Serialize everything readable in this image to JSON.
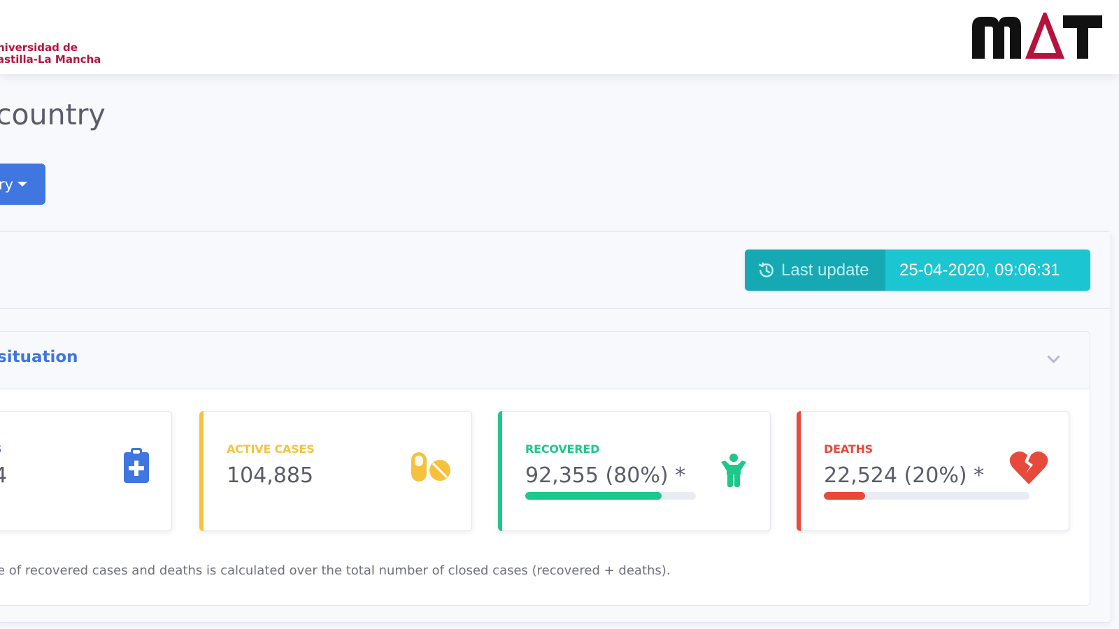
{
  "header": {
    "university_line1": "niversidad de",
    "university_line2": "astilla-La Mancha",
    "brand_logo": "MΔT"
  },
  "page": {
    "title": "country",
    "country_button_label": "ry"
  },
  "update": {
    "label": "Last update",
    "value": "25-04-2020, 09:06:31",
    "icon": "history-icon"
  },
  "section": {
    "title": "situation"
  },
  "stats": {
    "total": {
      "label": "S",
      "value": "4",
      "icon": "clipboard-medical-icon",
      "color": "#3f76e0"
    },
    "active": {
      "label": "ACTIVE CASES",
      "value": "104,885",
      "icon": "pills-icon",
      "color": "#f6c23e"
    },
    "recovered": {
      "label": "RECOVERED",
      "value": "92,355 (80%) *",
      "icon": "child-icon",
      "color": "#1cc88a",
      "progress_percent": 80
    },
    "deaths": {
      "label": "DEATHS",
      "value": "22,524 (20%) *",
      "icon": "heart-broken-icon",
      "color": "#e74a3b",
      "progress_percent": 20
    }
  },
  "footnote": "e of recovered cases and deaths is calculated over the total number of closed cases (recovered + deaths)."
}
